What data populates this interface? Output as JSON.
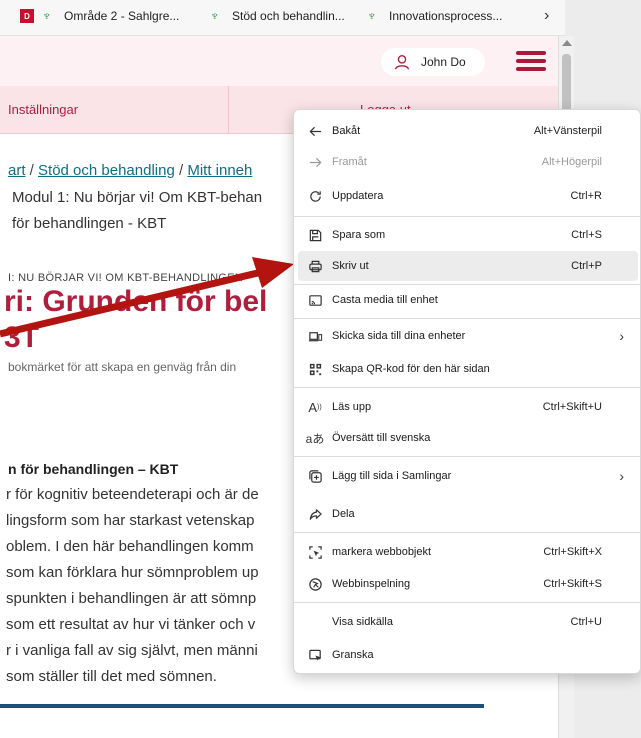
{
  "bookmarks": [
    {
      "label": "Område 2 - Sahlgre...",
      "icon": "vgr-icon"
    },
    {
      "label": "Stöd och behandlin...",
      "icon": "vgr-icon"
    },
    {
      "label": "Innovationsprocess...",
      "icon": "vgr-icon"
    }
  ],
  "bookmarks_first_favicon": "D",
  "bookmarks_more": "›",
  "header": {
    "user_name": "John Do"
  },
  "nav": {
    "settings": "Inställningar",
    "logout": "Logga ut"
  },
  "breadcrumb": {
    "part1": "art",
    "sep": " / ",
    "part2": "Stöd och behandling",
    "part3": "Mitt inneh",
    "line2": "Modul 1: Nu börjar vi! Om KBT-behan",
    "line3": "för behandlingen - KBT"
  },
  "kicker": "I: NU BÖRJAR VI! OM KBT-BEHANDLINGEN",
  "title": {
    "line1": "ri: Grunden för bel",
    "line2": "3T"
  },
  "hint": "bokmärket för att skapa en genväg från din",
  "section_heading": "n för behandlingen – KBT",
  "paragraph": [
    "r för kognitiv beteendeterapi och är de",
    "lingsform som har starkast vetenskap",
    "oblem. I den här behandlingen komm",
    "som kan förklara hur sömnproblem up",
    "spunkten i behandlingen är att sömnp",
    " som ett resultat av hur vi tänker och v",
    "r i vanliga fall av sig självt, men männi",
    "som ställer till det med sömnen."
  ],
  "menu": {
    "back": {
      "label": "Bakåt",
      "shortcut": "Alt+Vänsterpil"
    },
    "forward": {
      "label": "Framåt",
      "shortcut": "Alt+Högerpil"
    },
    "refresh": {
      "label": "Uppdatera",
      "shortcut": "Ctrl+R"
    },
    "save_as": {
      "label": "Spara som",
      "shortcut": "Ctrl+S"
    },
    "print": {
      "label": "Skriv ut",
      "shortcut": "Ctrl+P"
    },
    "cast": {
      "label": "Casta media till enhet"
    },
    "send_to_devices": {
      "label": "Skicka sida till dina enheter"
    },
    "qr": {
      "label": "Skapa QR-kod för den här sidan"
    },
    "read_aloud": {
      "label": "Läs upp",
      "shortcut": "Ctrl+Skift+U"
    },
    "translate": {
      "label": "Översätt till svenska"
    },
    "collections": {
      "label": "Lägg till sida i Samlingar"
    },
    "share": {
      "label": "Dela"
    },
    "web_select": {
      "label": "markera webbobjekt",
      "shortcut": "Ctrl+Skift+X"
    },
    "web_capture": {
      "label": "Webbinspelning",
      "shortcut": "Ctrl+Skift+S"
    },
    "view_source": {
      "label": "Visa sidkälla",
      "shortcut": "Ctrl+U"
    },
    "inspect": {
      "label": "Granska"
    }
  },
  "colors": {
    "brand_red": "#b01e3c",
    "annotation_arrow": "#b3140f",
    "link_teal": "#0e6e86"
  }
}
